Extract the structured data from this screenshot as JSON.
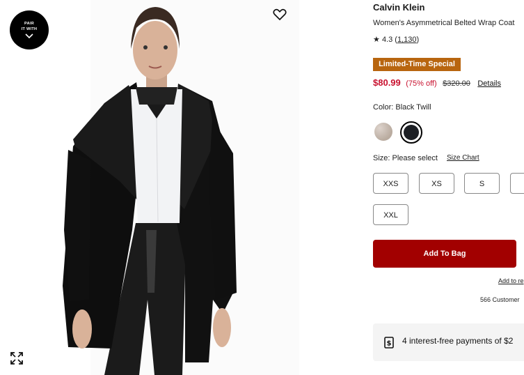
{
  "product": {
    "brand": "Calvin Klein",
    "name": "Women's Asymmetrical Belted Wrap Coat",
    "rating": "4.3",
    "review_count": "1,130",
    "badge": "Limited-Time Special",
    "sale_price": "$80.99",
    "discount": "(75% off)",
    "original_price": "$320.00",
    "details_link": "Details"
  },
  "image": {
    "pair_with_line1": "PAIR",
    "pair_with_line2": "IT WITH",
    "icons": [
      "chevron-down-icon",
      "heart-icon",
      "expand-icon"
    ]
  },
  "color": {
    "label": "Color: Black Twill",
    "swatches": [
      {
        "name": "Oatmeal",
        "hex": "#c8bcb5",
        "selected": false
      },
      {
        "name": "Black Twill",
        "hex": "#1c1f24",
        "selected": true
      }
    ]
  },
  "size": {
    "label": "Size: Please select",
    "chart_link": "Size Chart",
    "options": [
      "XXS",
      "XS",
      "S",
      "",
      "XXL"
    ]
  },
  "actions": {
    "add_to_bag": "Add To Bag",
    "add_to_registry": "Add to re",
    "customer_note": "566 Customer"
  },
  "payment": {
    "text": "4 interest-free payments of $2",
    "icon": "dollar-receipt-icon"
  },
  "colors": {
    "sale_red": "#c8102e",
    "bag_button": "#a20000",
    "badge_bg": "#b8650f"
  }
}
